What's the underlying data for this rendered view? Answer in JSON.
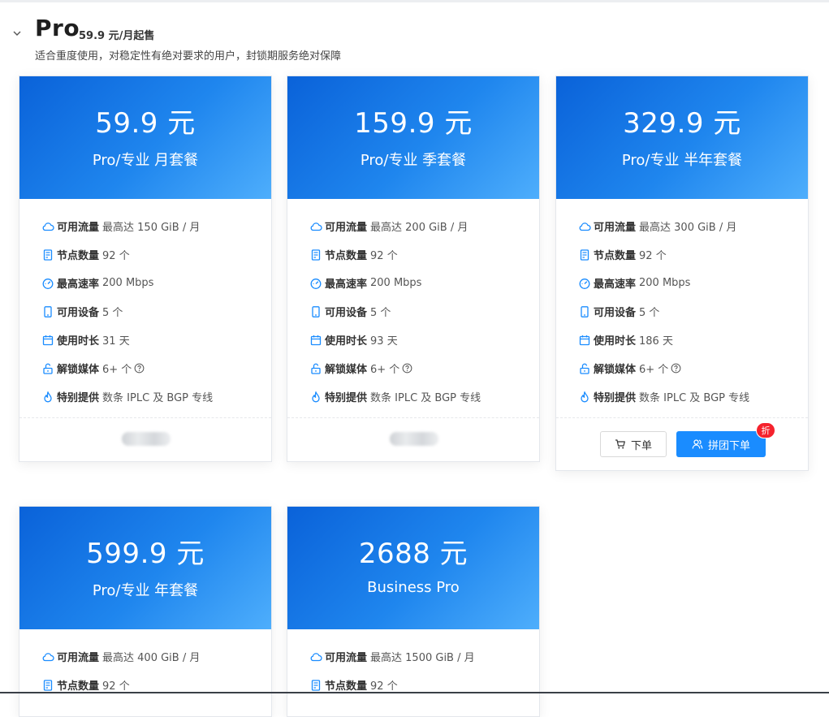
{
  "header": {
    "title": "Pro",
    "price_note": "59.9 元/月起售",
    "description": "适合重度使用，对稳定性有绝对要求的用户，封锁期服务绝对保障"
  },
  "colors": {
    "primary": "#1a8cff",
    "badge": "#f5222d",
    "icon": "#1a8cff"
  },
  "plans": [
    {
      "price": "59.9 元",
      "name": "Pro/专业 月套餐",
      "features": [
        {
          "label": "可用流量",
          "value": "最高达 150 GiB / 月",
          "icon": "cloud-icon"
        },
        {
          "label": "节点数量",
          "value": "92 个",
          "icon": "server-icon"
        },
        {
          "label": "最高速率",
          "value": "200 Mbps",
          "icon": "speedometer-icon"
        },
        {
          "label": "可用设备",
          "value": "5 个",
          "icon": "phone-icon"
        },
        {
          "label": "使用时长",
          "value": "31 天",
          "icon": "calendar-icon"
        },
        {
          "label": "解锁媒体",
          "value": "6+ 个",
          "icon": "unlock-icon"
        },
        {
          "label": "特别提供",
          "value": "数条 IPLC 及 BGP 专线",
          "icon": "flame-icon"
        }
      ]
    },
    {
      "price": "159.9 元",
      "name": "Pro/专业 季套餐",
      "features": [
        {
          "label": "可用流量",
          "value": "最高达 200 GiB / 月",
          "icon": "cloud-icon"
        },
        {
          "label": "节点数量",
          "value": "92 个",
          "icon": "server-icon"
        },
        {
          "label": "最高速率",
          "value": "200 Mbps",
          "icon": "speedometer-icon"
        },
        {
          "label": "可用设备",
          "value": "5 个",
          "icon": "phone-icon"
        },
        {
          "label": "使用时长",
          "value": "93 天",
          "icon": "calendar-icon"
        },
        {
          "label": "解锁媒体",
          "value": "6+ 个",
          "icon": "unlock-icon"
        },
        {
          "label": "特别提供",
          "value": "数条 IPLC 及 BGP 专线",
          "icon": "flame-icon"
        }
      ]
    },
    {
      "price": "329.9 元",
      "name": "Pro/专业 半年套餐",
      "features": [
        {
          "label": "可用流量",
          "value": "最高达 300 GiB / 月",
          "icon": "cloud-icon"
        },
        {
          "label": "节点数量",
          "value": "92 个",
          "icon": "server-icon"
        },
        {
          "label": "最高速率",
          "value": "200 Mbps",
          "icon": "speedometer-icon"
        },
        {
          "label": "可用设备",
          "value": "5 个",
          "icon": "phone-icon"
        },
        {
          "label": "使用时长",
          "value": "186 天",
          "icon": "calendar-icon"
        },
        {
          "label": "解锁媒体",
          "value": "6+ 个",
          "icon": "unlock-icon"
        },
        {
          "label": "特别提供",
          "value": "数条 IPLC 及 BGP 专线",
          "icon": "flame-icon"
        }
      ],
      "order_label": "下单",
      "group_label": "拼团下单",
      "badge": "折"
    },
    {
      "price": "599.9 元",
      "name": "Pro/专业 年套餐",
      "features": [
        {
          "label": "可用流量",
          "value": "最高达 400 GiB / 月",
          "icon": "cloud-icon"
        },
        {
          "label": "节点数量",
          "value": "92 个",
          "icon": "server-icon"
        }
      ]
    },
    {
      "price": "2688 元",
      "name": "Business Pro",
      "features": [
        {
          "label": "可用流量",
          "value": "最高达 1500 GiB / 月",
          "icon": "cloud-icon"
        },
        {
          "label": "节点数量",
          "value": "92 个",
          "icon": "server-icon"
        }
      ]
    }
  ]
}
